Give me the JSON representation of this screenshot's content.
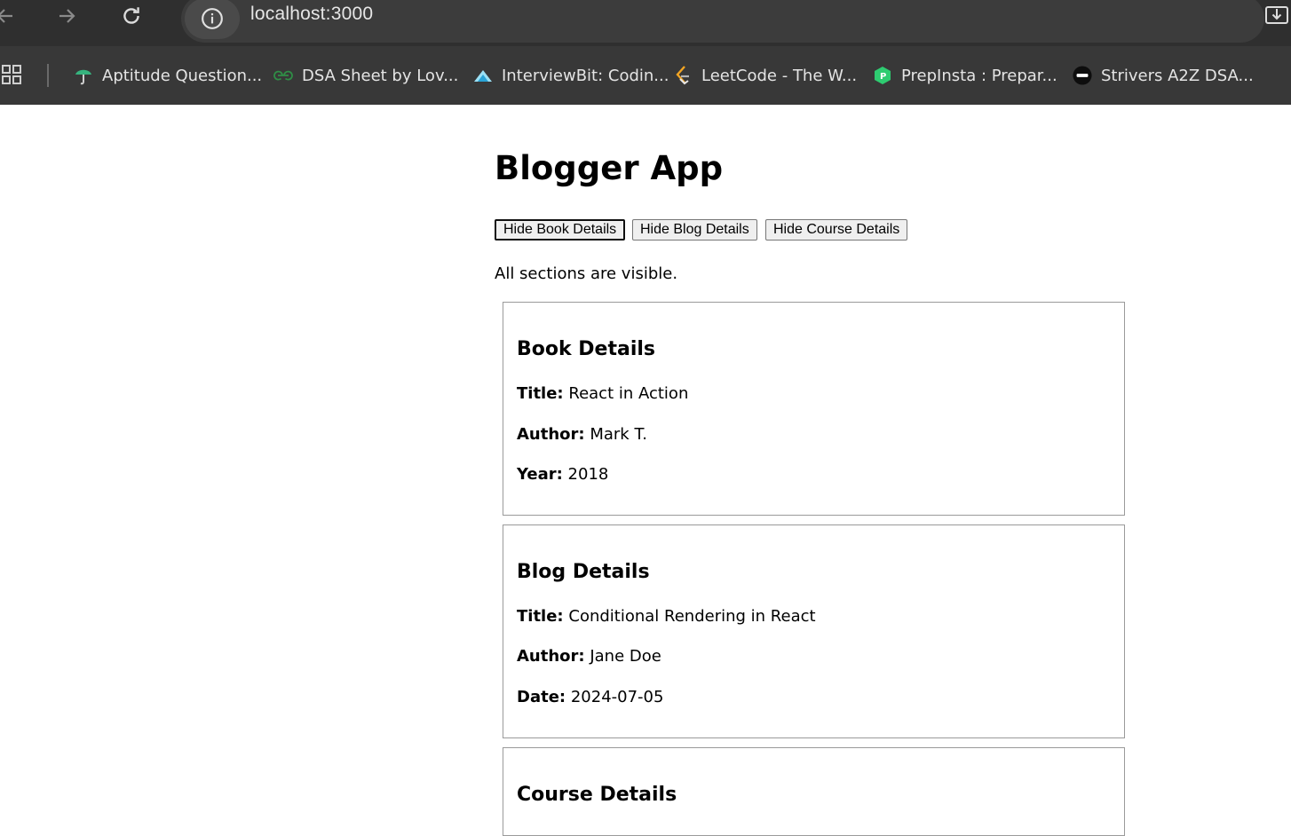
{
  "browser": {
    "url": "localhost:3000",
    "bookmarks": [
      {
        "label": "Aptitude Question...",
        "icon": "indiabix-icon"
      },
      {
        "label": "DSA Sheet by Lov...",
        "icon": "geeksforgeeks-icon"
      },
      {
        "label": "InterviewBit: Codin...",
        "icon": "interviewbit-icon"
      },
      {
        "label": "LeetCode - The W...",
        "icon": "leetcode-icon"
      },
      {
        "label": "PrepInsta : Prepar...",
        "icon": "prepinsta-icon"
      },
      {
        "label": "Strivers A2Z DSA...",
        "icon": "tuf-icon"
      }
    ]
  },
  "app": {
    "title": "Blogger App",
    "buttons": {
      "hide_book": "Hide Book Details",
      "hide_blog": "Hide Blog Details",
      "hide_course": "Hide Course Details"
    },
    "status": "All sections are visible."
  },
  "book": {
    "heading": "Book Details",
    "title_label": "Title:",
    "title": "React in Action",
    "author_label": "Author:",
    "author": "Mark T.",
    "year_label": "Year:",
    "year": "2018"
  },
  "blog": {
    "heading": "Blog Details",
    "title_label": "Title:",
    "title": "Conditional Rendering in React",
    "author_label": "Author:",
    "author": "Jane Doe",
    "date_label": "Date:",
    "date": "2024-07-05"
  },
  "course": {
    "heading": "Course Details"
  },
  "colors": {
    "chrome_dark": "#2f2f2f",
    "bookmark_bar": "#383838",
    "card_border": "#9a9a9a"
  }
}
